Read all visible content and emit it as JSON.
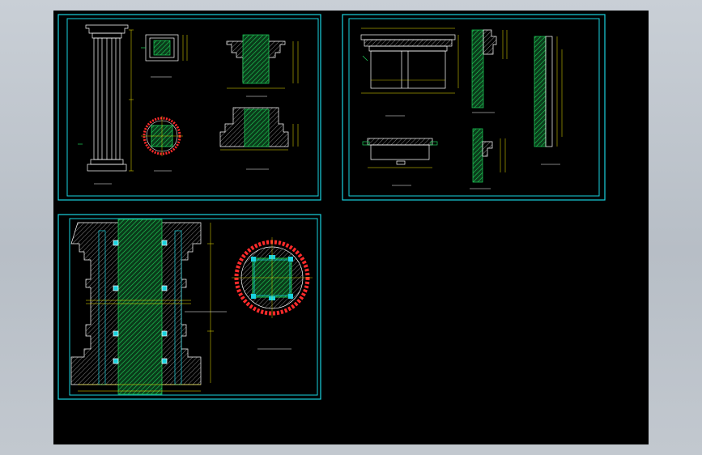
{
  "colors": {
    "app_background": "#c3c9d0",
    "canvas": "#000000",
    "frame": "#19d3df",
    "line_white": "#ffffff",
    "hatch_green": "#1fd35a",
    "dim_yellow": "#f3e600",
    "hatch_red": "#ff2b2b",
    "accent_magenta": "#e0409a"
  },
  "icons": [
    "cad-viewport-icon"
  ],
  "sheets": [
    {
      "id": "sheet-1",
      "drawings": [
        "column-elevation",
        "capital-plan",
        "capital-section",
        "shaft-section-circular",
        "base-section"
      ]
    },
    {
      "id": "sheet-2",
      "drawings": [
        "entablature-elevation",
        "cornice-profile",
        "wall-section",
        "footing-detail",
        "profile-detail",
        "cladding-profile"
      ]
    },
    {
      "id": "sheet-3",
      "drawings": [
        "column-section-large",
        "column-plan-large"
      ]
    }
  ]
}
